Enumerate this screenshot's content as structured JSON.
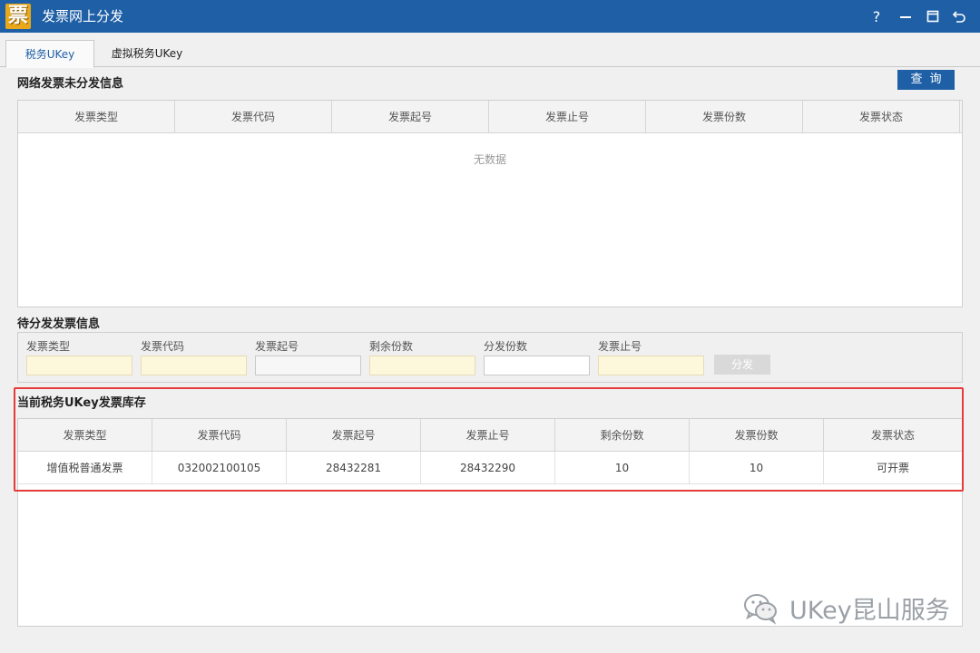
{
  "window": {
    "logo_char": "票",
    "title": "发票网上分发",
    "controls": {
      "help": "?"
    }
  },
  "tabs": [
    {
      "label": "税务UKey",
      "active": true
    },
    {
      "label": "虚拟税务UKey",
      "active": false
    }
  ],
  "network_section": {
    "title": "网络发票未分发信息",
    "query_button": "查询",
    "columns": [
      "发票类型",
      "发票代码",
      "发票起号",
      "发票止号",
      "发票份数",
      "发票状态"
    ],
    "empty_text": "无数据"
  },
  "pending_section": {
    "title": "待分发发票信息",
    "fields": [
      {
        "label": "发票类型",
        "value": ""
      },
      {
        "label": "发票代码",
        "value": ""
      },
      {
        "label": "发票起号",
        "value": ""
      },
      {
        "label": "剩余份数",
        "value": ""
      },
      {
        "label": "分发份数",
        "value": ""
      },
      {
        "label": "发票止号",
        "value": ""
      }
    ],
    "distribute_button": "分发"
  },
  "inventory_section": {
    "title": "当前税务UKey发票库存",
    "columns": [
      "发票类型",
      "发票代码",
      "发票起号",
      "发票止号",
      "剩余份数",
      "发票份数",
      "发票状态"
    ],
    "rows": [
      [
        "增值税普通发票",
        "032002100105",
        "28432281",
        "28432290",
        "10",
        "10",
        "可开票"
      ]
    ]
  },
  "watermark": {
    "text": "UKey昆山服务"
  },
  "colors": {
    "brand": "#1f5fa6",
    "highlight": "#e53b3b",
    "readonly_bg": "#fdf7dc"
  }
}
